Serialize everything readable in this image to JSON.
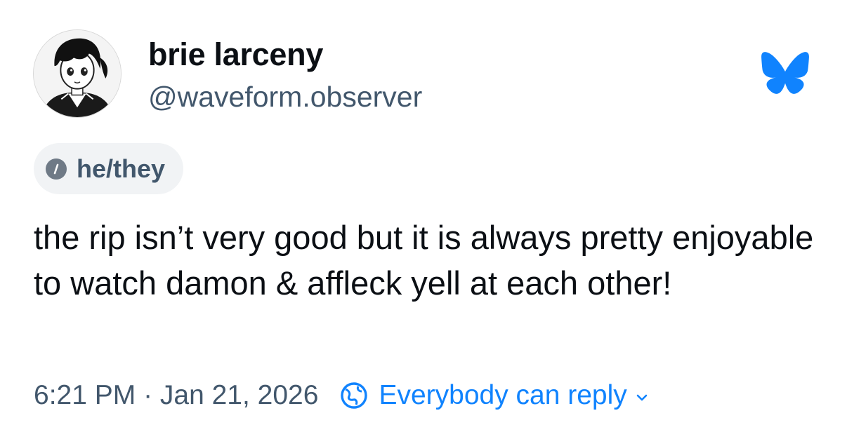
{
  "author": {
    "display_name": "brie larceny",
    "handle": "@waveform.observer",
    "avatar_icon": "anime-character-avatar"
  },
  "app": {
    "logo_icon": "bluesky-butterfly-icon",
    "brand_color": "#1083fe"
  },
  "profile": {
    "pronouns": "he/they",
    "pronouns_icon": "pronouns-info-icon"
  },
  "post": {
    "text": "the rip isn’t very good but it is always pretty enjoyable to watch damon & affleck yell at each other!"
  },
  "footer": {
    "timestamp": "6:21 PM · Jan 21, 2026",
    "reply_setting": "Everybody can reply",
    "reply_icon": "globe-icon",
    "dropdown_icon": "chevron-down-icon"
  },
  "colors": {
    "primary_text": "#0b0f14",
    "secondary_text": "#42576c",
    "pill_background": "#f1f3f5"
  }
}
